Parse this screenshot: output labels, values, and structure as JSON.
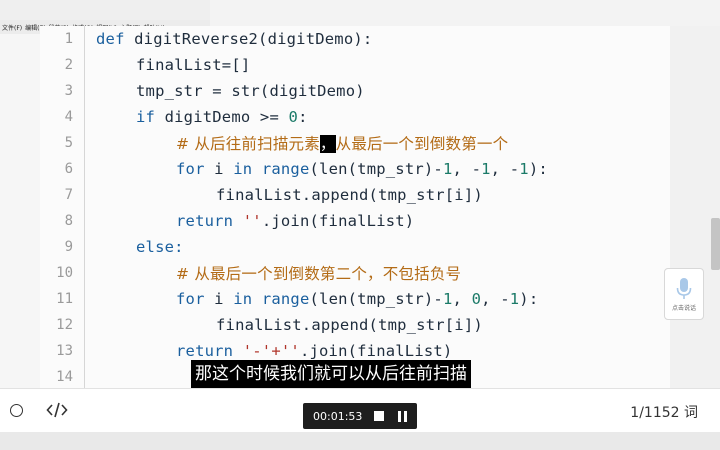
{
  "menubar": {
    "items": [
      "文件(F)",
      "编辑(E)",
      "段落(P)",
      "格式(O)",
      "视图(V)",
      "主题(T)",
      "帮助(H)"
    ]
  },
  "editor": {
    "lines": [
      {
        "n": "1"
      },
      {
        "n": "2"
      },
      {
        "n": "3"
      },
      {
        "n": "4"
      },
      {
        "n": "5"
      },
      {
        "n": "6"
      },
      {
        "n": "7"
      },
      {
        "n": "8"
      },
      {
        "n": "9"
      },
      {
        "n": "10"
      },
      {
        "n": "11"
      },
      {
        "n": "12"
      },
      {
        "n": "13"
      },
      {
        "n": "14"
      }
    ],
    "tokens": {
      "l1_def": "def",
      "l1_rest": " digitReverse2(digitDemo):",
      "l2": "finalList=[]",
      "l3": "tmp_str = str(digitDemo)",
      "l4_if": "if",
      "l4_mid": " digitDemo >= ",
      "l4_num": "0",
      "l4_end": ":",
      "l5_a": "# 从后往前扫描元素",
      "l5_cursor": "，",
      "l5_b": "从最后一个到倒数第一个",
      "l6_for": "for",
      "l6_i": " i ",
      "l6_in": "in",
      "l6_range": " range",
      "l6_mid": "(len(tmp_str)-",
      "l6_n1": "1",
      "l6_c1": ", -",
      "l6_n2": "1",
      "l6_c2": ", -",
      "l6_n3": "1",
      "l6_end": "):",
      "l7": "finalList.append(tmp_str[i])",
      "l8_ret": "return",
      "l8_str": " ''",
      "l8_rest": ".join(finalList)",
      "l9": "else:",
      "l10": "# 从最后一个到倒数第二个，不包括负号",
      "l11_for": "for",
      "l11_i": " i ",
      "l11_in": "in",
      "l11_range": " range",
      "l11_mid": "(len(tmp_str)-",
      "l11_n1": "1",
      "l11_c1": ", ",
      "l11_n2": "0",
      "l11_c2": ", -",
      "l11_n3": "1",
      "l11_end": "):",
      "l12": "finalList.append(tmp_str[i])",
      "l13_ret": "return",
      "l13_str": " '-'+''",
      "l13_rest": ".join(finalList)"
    }
  },
  "voice_widget": {
    "label": "点击说话",
    "icon": "microphone-icon"
  },
  "subtitle": "那这个时候我们就可以从后往前扫描",
  "player": {
    "time": "00:01:53",
    "progress": "1/1152 词",
    "icons": [
      "circle-icon",
      "code-icon",
      "stop-icon",
      "pause-icon"
    ]
  },
  "colors": {
    "keyword": "#1a5f9e",
    "string": "#b0342a",
    "number": "#1b7a68",
    "comment": "#b36b16"
  }
}
